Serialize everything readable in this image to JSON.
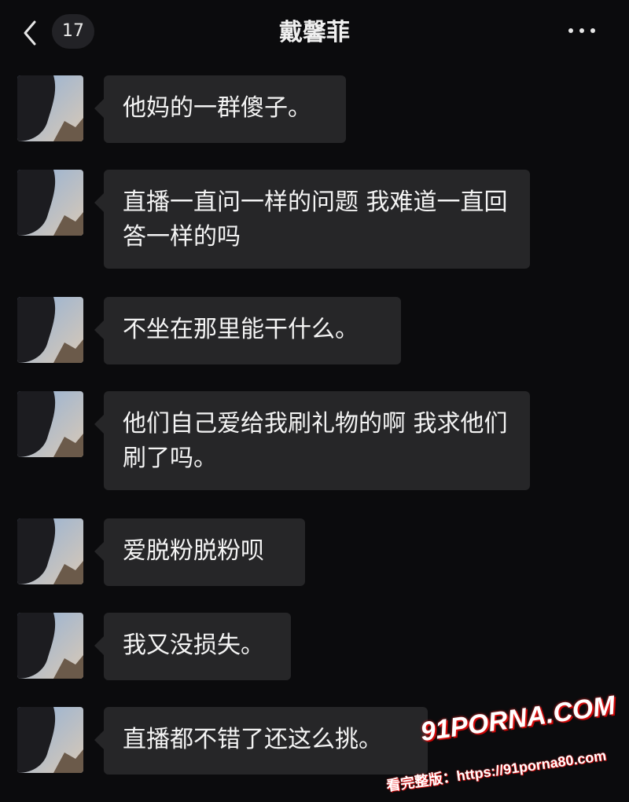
{
  "header": {
    "back_icon": "chevron-left-icon",
    "unread_count": "17",
    "title": "戴馨菲",
    "more_icon": "more-horizontal-icon"
  },
  "messages": [
    {
      "text": "他妈的一群傻子。"
    },
    {
      "text": "直播一直问一样的问题 我难道一直回答一样的吗"
    },
    {
      "text": "不坐在那里能干什么。"
    },
    {
      "text": "他们自己爱给我刷礼物的啊 我求他们刷了吗。"
    },
    {
      "text": "爱脱粉脱粉呗"
    },
    {
      "text": "我又没损失。"
    },
    {
      "text": "直播都不错了还这么挑。"
    }
  ],
  "watermark": {
    "logo": "91PORNA.COM",
    "url": "看完整版：https://91porna80.com"
  },
  "colors": {
    "background": "#0b0b0d",
    "bubble": "#262628",
    "text": "#f4f4f4",
    "watermark_accent": "#ff2a2a"
  }
}
